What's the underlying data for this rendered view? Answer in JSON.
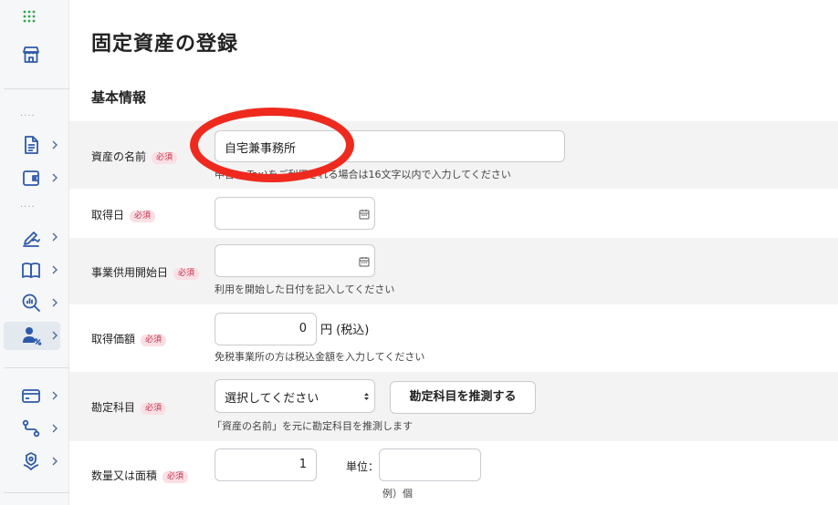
{
  "page": {
    "title": "固定資産の登録",
    "section_title": "基本情報"
  },
  "required_label": "必須",
  "sidebar": {
    "items": [
      {
        "name": "apps-grid-icon"
      },
      {
        "name": "store-icon"
      },
      {
        "name": "document-icon"
      },
      {
        "name": "wallet-icon"
      },
      {
        "name": "signature-icon"
      },
      {
        "name": "book-icon"
      },
      {
        "name": "analytics-search-icon"
      },
      {
        "name": "user-percent-icon"
      },
      {
        "name": "card-icon"
      },
      {
        "name": "route-icon"
      },
      {
        "name": "hand-badge-icon"
      }
    ]
  },
  "form": {
    "asset_name": {
      "label": "資産の名前",
      "value": "自宅兼事務所",
      "help": "申告(e-Tax)をご利用される場合は16文字以内で入力してください"
    },
    "acquisition_date": {
      "label": "取得日",
      "value": ""
    },
    "business_start_date": {
      "label": "事業供用開始日",
      "value": "",
      "help": "利用を開始した日付を記入してください"
    },
    "acquisition_price": {
      "label": "取得価額",
      "value": "0",
      "unit": "円 (税込)",
      "help": "免税事業所の方は税込金額を入力してください"
    },
    "account": {
      "label": "勘定科目",
      "selected": "選択してください",
      "guess_button": "勘定科目を推測する",
      "help": "「資産の名前」を元に勘定科目を推測します"
    },
    "quantity": {
      "label": "数量又は面積",
      "value": "1",
      "unit_label": "単位：",
      "unit_value": "",
      "unit_example": "例）個"
    }
  },
  "colors": {
    "required_text": "#c2314a",
    "required_bg": "#fbdfe4",
    "annotation": "#ee2a1e",
    "icon_blue": "#2d5aa8",
    "apps_green": "#2fa84f"
  }
}
